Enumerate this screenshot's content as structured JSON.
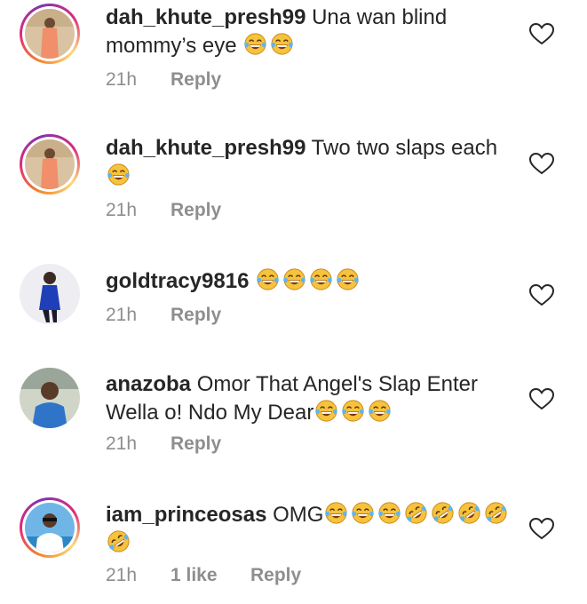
{
  "comments": [
    {
      "username": "dah_khute_presh99",
      "text": "Una wan blind mommy’s eye",
      "emojis": [
        "joy",
        "joy"
      ],
      "time": "21h",
      "reply": "Reply",
      "story_ring": true
    },
    {
      "username": "dah_khute_presh99",
      "text": "Two two slaps each",
      "emojis": [
        "joy"
      ],
      "time": "21h",
      "reply": "Reply",
      "story_ring": true
    },
    {
      "username": "goldtracy9816",
      "text": "",
      "emojis": [
        "joy",
        "joy",
        "joy",
        "joy"
      ],
      "time": "21h",
      "reply": "Reply",
      "story_ring": false
    },
    {
      "username": "anazoba",
      "text": "Omor That Angel's Slap Enter Wella o! Ndo My Dear",
      "emojis": [
        "joy",
        "joy",
        "joy"
      ],
      "time": "21h",
      "reply": "Reply",
      "story_ring": false
    },
    {
      "username": "iam_princeosas",
      "text": "OMG",
      "emojis": [
        "joy",
        "joy",
        "joy",
        "rofl",
        "rofl",
        "rofl",
        "rofl",
        "rofl"
      ],
      "time": "21h",
      "likes": "1 like",
      "reply": "Reply",
      "story_ring": true
    }
  ],
  "icons": {
    "like": "heart-outline-icon",
    "emoji_joy": "face-with-tears-of-joy",
    "emoji_rofl": "rolling-on-the-floor-laughing"
  },
  "colors": {
    "text": "#262626",
    "meta": "#8e8e8e",
    "emoji": "#f7c23c"
  }
}
